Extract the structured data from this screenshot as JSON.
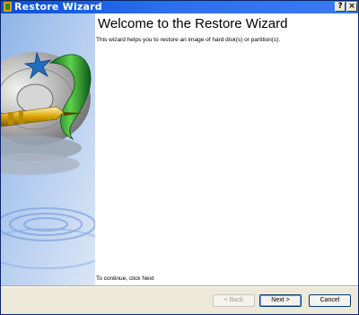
{
  "window": {
    "title": "Restore Wizard",
    "help_glyph": "?",
    "close_glyph": "×"
  },
  "page": {
    "heading": "Welcome to the Restore Wizard",
    "description": "This wizard helps you to restore an image of hard disk(s) or partition(s).",
    "footer_hint": "To continue, click Next"
  },
  "buttons": {
    "back": "< Back",
    "next": "Next >",
    "cancel": "Cancel"
  },
  "colors": {
    "titlebar": "#0a4fd6",
    "dialog_bg": "#ece9d8",
    "content_bg": "#ffffff",
    "button_border": "#003c74"
  },
  "icons": {
    "app": "restore-app-icon",
    "help": "help-icon",
    "close": "close-icon",
    "art": "disk-illustration"
  }
}
